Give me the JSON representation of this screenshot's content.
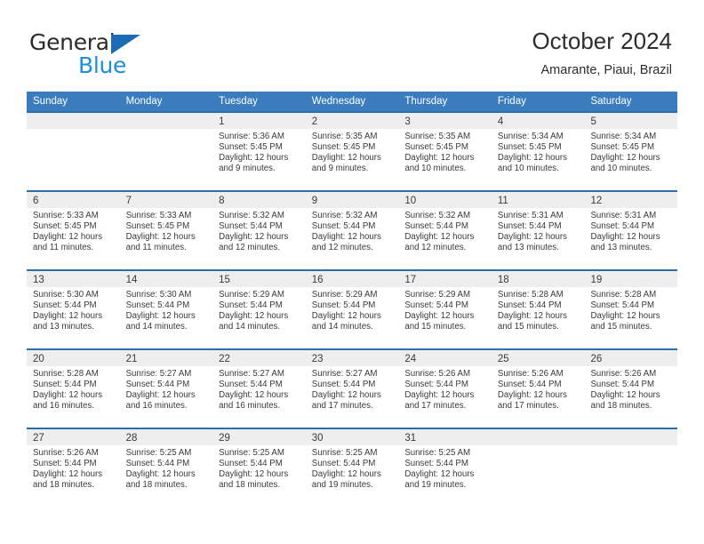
{
  "brand": {
    "name_top": "General",
    "name_bottom": "Blue",
    "triangle_color": "#1b6cb5",
    "blue_text_color": "#1b8ede"
  },
  "header": {
    "title": "October 2024",
    "subtitle": "Amarante, Piaui, Brazil"
  },
  "theme": {
    "header_row_bg": "#3a7cbe",
    "cell_top_border": "#2e6da9",
    "day_band_bg": "#eeeeee"
  },
  "weekdays": [
    "Sunday",
    "Monday",
    "Tuesday",
    "Wednesday",
    "Thursday",
    "Friday",
    "Saturday"
  ],
  "labels": {
    "sunrise_prefix": "Sunrise: ",
    "sunset_prefix": "Sunset: ",
    "daylight_prefix": "Daylight: "
  },
  "weeks": [
    [
      {
        "day": "",
        "sunrise": "",
        "sunset": "",
        "daylight_l1": "",
        "daylight_l2": ""
      },
      {
        "day": "",
        "sunrise": "",
        "sunset": "",
        "daylight_l1": "",
        "daylight_l2": ""
      },
      {
        "day": "1",
        "sunrise": "Sunrise: 5:36 AM",
        "sunset": "Sunset: 5:45 PM",
        "daylight_l1": "Daylight: 12 hours",
        "daylight_l2": "and 9 minutes."
      },
      {
        "day": "2",
        "sunrise": "Sunrise: 5:35 AM",
        "sunset": "Sunset: 5:45 PM",
        "daylight_l1": "Daylight: 12 hours",
        "daylight_l2": "and 9 minutes."
      },
      {
        "day": "3",
        "sunrise": "Sunrise: 5:35 AM",
        "sunset": "Sunset: 5:45 PM",
        "daylight_l1": "Daylight: 12 hours",
        "daylight_l2": "and 10 minutes."
      },
      {
        "day": "4",
        "sunrise": "Sunrise: 5:34 AM",
        "sunset": "Sunset: 5:45 PM",
        "daylight_l1": "Daylight: 12 hours",
        "daylight_l2": "and 10 minutes."
      },
      {
        "day": "5",
        "sunrise": "Sunrise: 5:34 AM",
        "sunset": "Sunset: 5:45 PM",
        "daylight_l1": "Daylight: 12 hours",
        "daylight_l2": "and 10 minutes."
      }
    ],
    [
      {
        "day": "6",
        "sunrise": "Sunrise: 5:33 AM",
        "sunset": "Sunset: 5:45 PM",
        "daylight_l1": "Daylight: 12 hours",
        "daylight_l2": "and 11 minutes."
      },
      {
        "day": "7",
        "sunrise": "Sunrise: 5:33 AM",
        "sunset": "Sunset: 5:45 PM",
        "daylight_l1": "Daylight: 12 hours",
        "daylight_l2": "and 11 minutes."
      },
      {
        "day": "8",
        "sunrise": "Sunrise: 5:32 AM",
        "sunset": "Sunset: 5:44 PM",
        "daylight_l1": "Daylight: 12 hours",
        "daylight_l2": "and 12 minutes."
      },
      {
        "day": "9",
        "sunrise": "Sunrise: 5:32 AM",
        "sunset": "Sunset: 5:44 PM",
        "daylight_l1": "Daylight: 12 hours",
        "daylight_l2": "and 12 minutes."
      },
      {
        "day": "10",
        "sunrise": "Sunrise: 5:32 AM",
        "sunset": "Sunset: 5:44 PM",
        "daylight_l1": "Daylight: 12 hours",
        "daylight_l2": "and 12 minutes."
      },
      {
        "day": "11",
        "sunrise": "Sunrise: 5:31 AM",
        "sunset": "Sunset: 5:44 PM",
        "daylight_l1": "Daylight: 12 hours",
        "daylight_l2": "and 13 minutes."
      },
      {
        "day": "12",
        "sunrise": "Sunrise: 5:31 AM",
        "sunset": "Sunset: 5:44 PM",
        "daylight_l1": "Daylight: 12 hours",
        "daylight_l2": "and 13 minutes."
      }
    ],
    [
      {
        "day": "13",
        "sunrise": "Sunrise: 5:30 AM",
        "sunset": "Sunset: 5:44 PM",
        "daylight_l1": "Daylight: 12 hours",
        "daylight_l2": "and 13 minutes."
      },
      {
        "day": "14",
        "sunrise": "Sunrise: 5:30 AM",
        "sunset": "Sunset: 5:44 PM",
        "daylight_l1": "Daylight: 12 hours",
        "daylight_l2": "and 14 minutes."
      },
      {
        "day": "15",
        "sunrise": "Sunrise: 5:29 AM",
        "sunset": "Sunset: 5:44 PM",
        "daylight_l1": "Daylight: 12 hours",
        "daylight_l2": "and 14 minutes."
      },
      {
        "day": "16",
        "sunrise": "Sunrise: 5:29 AM",
        "sunset": "Sunset: 5:44 PM",
        "daylight_l1": "Daylight: 12 hours",
        "daylight_l2": "and 14 minutes."
      },
      {
        "day": "17",
        "sunrise": "Sunrise: 5:29 AM",
        "sunset": "Sunset: 5:44 PM",
        "daylight_l1": "Daylight: 12 hours",
        "daylight_l2": "and 15 minutes."
      },
      {
        "day": "18",
        "sunrise": "Sunrise: 5:28 AM",
        "sunset": "Sunset: 5:44 PM",
        "daylight_l1": "Daylight: 12 hours",
        "daylight_l2": "and 15 minutes."
      },
      {
        "day": "19",
        "sunrise": "Sunrise: 5:28 AM",
        "sunset": "Sunset: 5:44 PM",
        "daylight_l1": "Daylight: 12 hours",
        "daylight_l2": "and 15 minutes."
      }
    ],
    [
      {
        "day": "20",
        "sunrise": "Sunrise: 5:28 AM",
        "sunset": "Sunset: 5:44 PM",
        "daylight_l1": "Daylight: 12 hours",
        "daylight_l2": "and 16 minutes."
      },
      {
        "day": "21",
        "sunrise": "Sunrise: 5:27 AM",
        "sunset": "Sunset: 5:44 PM",
        "daylight_l1": "Daylight: 12 hours",
        "daylight_l2": "and 16 minutes."
      },
      {
        "day": "22",
        "sunrise": "Sunrise: 5:27 AM",
        "sunset": "Sunset: 5:44 PM",
        "daylight_l1": "Daylight: 12 hours",
        "daylight_l2": "and 16 minutes."
      },
      {
        "day": "23",
        "sunrise": "Sunrise: 5:27 AM",
        "sunset": "Sunset: 5:44 PM",
        "daylight_l1": "Daylight: 12 hours",
        "daylight_l2": "and 17 minutes."
      },
      {
        "day": "24",
        "sunrise": "Sunrise: 5:26 AM",
        "sunset": "Sunset: 5:44 PM",
        "daylight_l1": "Daylight: 12 hours",
        "daylight_l2": "and 17 minutes."
      },
      {
        "day": "25",
        "sunrise": "Sunrise: 5:26 AM",
        "sunset": "Sunset: 5:44 PM",
        "daylight_l1": "Daylight: 12 hours",
        "daylight_l2": "and 17 minutes."
      },
      {
        "day": "26",
        "sunrise": "Sunrise: 5:26 AM",
        "sunset": "Sunset: 5:44 PM",
        "daylight_l1": "Daylight: 12 hours",
        "daylight_l2": "and 18 minutes."
      }
    ],
    [
      {
        "day": "27",
        "sunrise": "Sunrise: 5:26 AM",
        "sunset": "Sunset: 5:44 PM",
        "daylight_l1": "Daylight: 12 hours",
        "daylight_l2": "and 18 minutes."
      },
      {
        "day": "28",
        "sunrise": "Sunrise: 5:25 AM",
        "sunset": "Sunset: 5:44 PM",
        "daylight_l1": "Daylight: 12 hours",
        "daylight_l2": "and 18 minutes."
      },
      {
        "day": "29",
        "sunrise": "Sunrise: 5:25 AM",
        "sunset": "Sunset: 5:44 PM",
        "daylight_l1": "Daylight: 12 hours",
        "daylight_l2": "and 18 minutes."
      },
      {
        "day": "30",
        "sunrise": "Sunrise: 5:25 AM",
        "sunset": "Sunset: 5:44 PM",
        "daylight_l1": "Daylight: 12 hours",
        "daylight_l2": "and 19 minutes."
      },
      {
        "day": "31",
        "sunrise": "Sunrise: 5:25 AM",
        "sunset": "Sunset: 5:44 PM",
        "daylight_l1": "Daylight: 12 hours",
        "daylight_l2": "and 19 minutes."
      },
      {
        "day": "",
        "sunrise": "",
        "sunset": "",
        "daylight_l1": "",
        "daylight_l2": ""
      },
      {
        "day": "",
        "sunrise": "",
        "sunset": "",
        "daylight_l1": "",
        "daylight_l2": ""
      }
    ]
  ]
}
